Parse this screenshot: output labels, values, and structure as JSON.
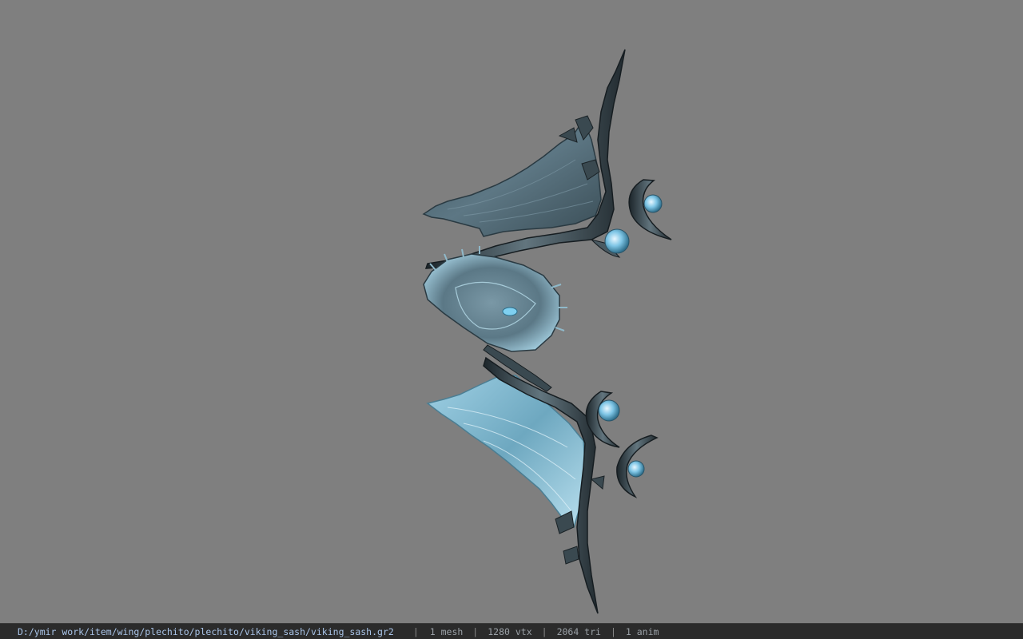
{
  "window": {
    "background_color": "#7f7f7f"
  },
  "viewport": {
    "model_icon": "wing-model"
  },
  "statusbar": {
    "file_path": "D:/ymir work/item/wing/plechito/plechito/viking_sash/viking_sash.gr2",
    "separator": "|",
    "mesh_count": "1 mesh",
    "vertex_count": "1280 vtx",
    "triangle_count": "2064 tri",
    "anim_count": "1 anim"
  }
}
